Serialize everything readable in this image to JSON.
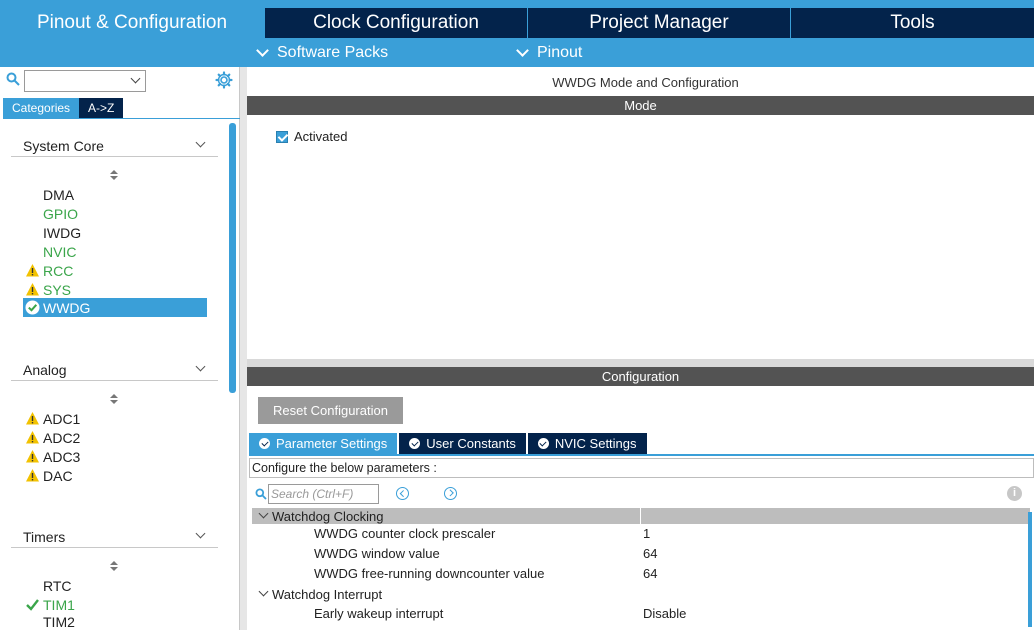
{
  "top_tabs": [
    {
      "label": "Pinout & Configuration",
      "active": true
    },
    {
      "label": "Clock Configuration",
      "active": false
    },
    {
      "label": "Project Manager",
      "active": false
    },
    {
      "label": "Tools",
      "active": false
    }
  ],
  "subbar": {
    "software_packs": "Software Packs",
    "pinout": "Pinout"
  },
  "left": {
    "search_value": "",
    "tabs": {
      "categories": "Categories",
      "az": "A->Z"
    },
    "sections": [
      {
        "title": "System Core",
        "items": [
          {
            "label": "DMA",
            "status": "none"
          },
          {
            "label": "GPIO",
            "status": "green"
          },
          {
            "label": "IWDG",
            "status": "none"
          },
          {
            "label": "NVIC",
            "status": "green"
          },
          {
            "label": "RCC",
            "status": "warning"
          },
          {
            "label": "SYS",
            "status": "warning"
          },
          {
            "label": "WWDG",
            "status": "selected"
          }
        ]
      },
      {
        "title": "Analog",
        "items": [
          {
            "label": "ADC1",
            "status": "warning"
          },
          {
            "label": "ADC2",
            "status": "warning"
          },
          {
            "label": "ADC3",
            "status": "warning"
          },
          {
            "label": "DAC",
            "status": "warning"
          }
        ]
      },
      {
        "title": "Timers",
        "items": [
          {
            "label": "RTC",
            "status": "none"
          },
          {
            "label": "TIM1",
            "status": "check"
          },
          {
            "label": "TIM2",
            "status": "none"
          }
        ]
      }
    ]
  },
  "right": {
    "title": "WWDG Mode and Configuration",
    "mode_header": "Mode",
    "activated_label": "Activated",
    "activated_checked": true,
    "config_header": "Configuration",
    "reset_button": "Reset Configuration",
    "param_tabs": [
      "Parameter Settings",
      "User Constants",
      "NVIC Settings"
    ],
    "hint": "Configure the below parameters :",
    "search_placeholder": "Search (Ctrl+F)",
    "groups": [
      {
        "title": "Watchdog Clocking",
        "rows": [
          {
            "name": "WWDG counter clock prescaler",
            "value": "1"
          },
          {
            "name": "WWDG window value",
            "value": "64"
          },
          {
            "name": "WWDG free-running downcounter value",
            "value": "64"
          }
        ]
      },
      {
        "title": "Watchdog Interrupt",
        "rows": [
          {
            "name": "Early wakeup interrupt",
            "value": "Disable"
          }
        ]
      }
    ]
  },
  "colors": {
    "accent": "#3a9fd8",
    "navy": "#03234b",
    "green": "#3aa54a",
    "warning": "#f2c200",
    "bar": "#535353"
  }
}
